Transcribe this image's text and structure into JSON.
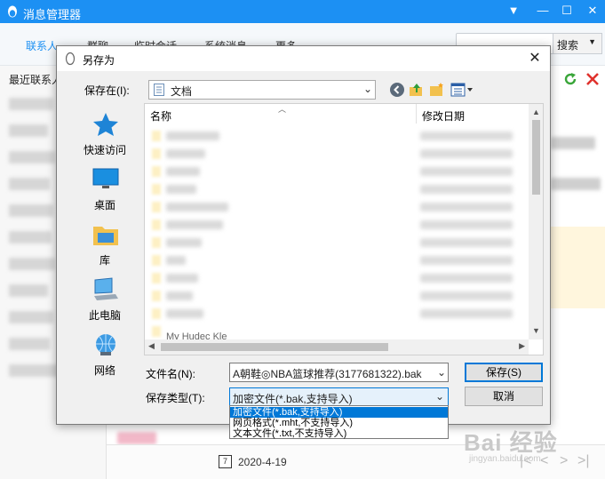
{
  "app": {
    "title": "消息管理器",
    "tabs": [
      "联系人",
      "群聊",
      "临时会话",
      "系统消息",
      "更多"
    ],
    "search_button": "搜索",
    "left_subtitle": "最近联系人",
    "date": "2020-4-19",
    "calendar_day": "7"
  },
  "dialog": {
    "title": "另存为",
    "save_in_label": "保存在(I):",
    "save_in_value": "文档",
    "places": [
      "快速访问",
      "桌面",
      "库",
      "此电脑",
      "网络"
    ],
    "columns": {
      "name": "名称",
      "date": "修改日期"
    },
    "partial_row": "My Hudec Kle",
    "filename_label": "文件名(N):",
    "filename_value": "A朝鞋◎NBA篮球推荐(3177681322).bak",
    "filetype_label": "保存类型(T):",
    "filetype_value": "加密文件(*.bak,支持导入)",
    "filetype_options": [
      "加密文件(*.bak,支持导入)",
      "网页格式(*.mht,不支持导入)",
      "文本文件(*.txt,不支持导入)"
    ],
    "save_button": "保存(S)",
    "cancel_button": "取消"
  },
  "watermark": {
    "brand": "Bai 经验",
    "url": "jingyan.baidu.com"
  },
  "colors": {
    "accent": "#1c90f3",
    "selection": "#0078d7"
  }
}
